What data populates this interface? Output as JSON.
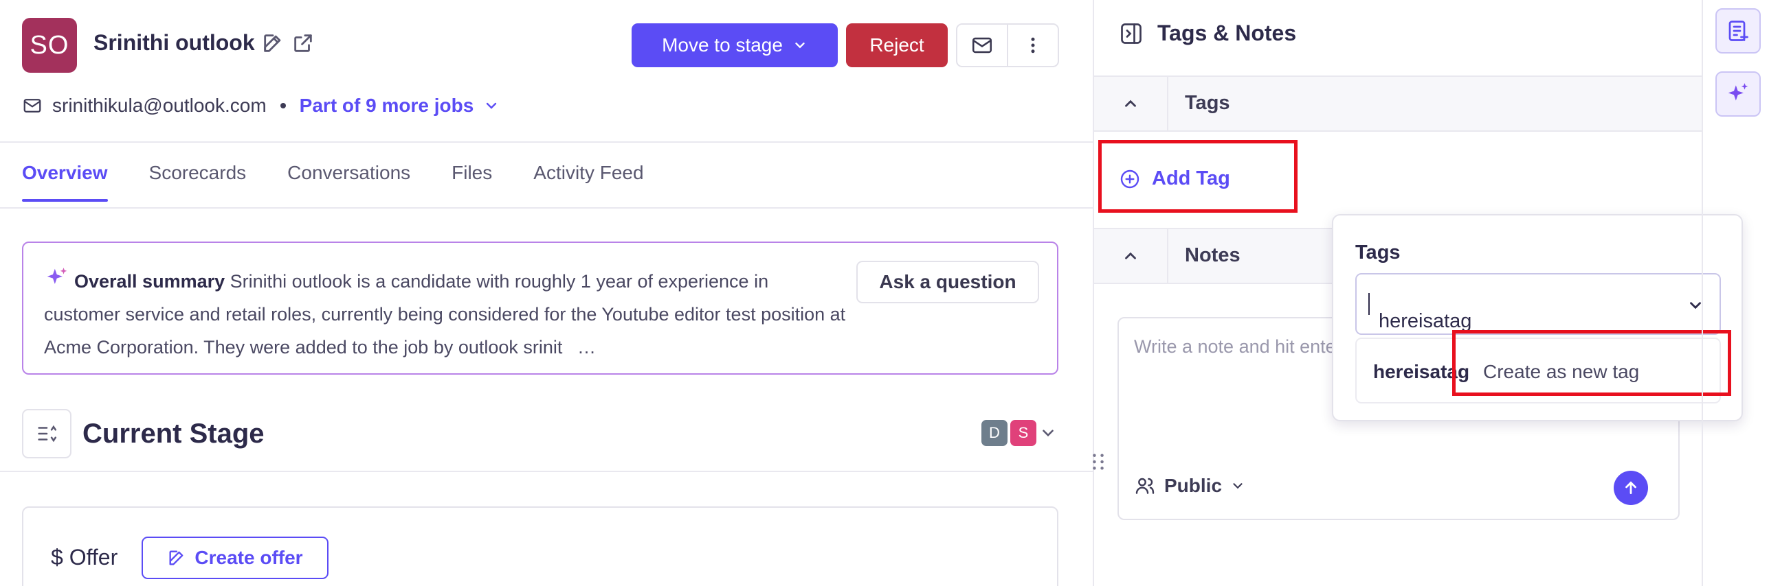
{
  "candidate": {
    "initials": "SO",
    "name": "Srinithi outlook",
    "email": "srinithikula@outlook.com",
    "more_jobs": "Part of 9 more jobs"
  },
  "actions": {
    "move_to_stage": "Move to stage",
    "reject": "Reject"
  },
  "tabs": [
    "Overview",
    "Scorecards",
    "Conversations",
    "Files",
    "Activity Feed"
  ],
  "summary": {
    "title": "Overall summary",
    "text": "Srinithi outlook is a candidate with roughly 1 year of experience in customer service and retail roles, currently being considered for the Youtube editor test position at Acme Corporation. They were added to the job by outlook srinit",
    "ellipsis": "…",
    "ask_button": "Ask a question"
  },
  "stage": {
    "title": "Current Stage",
    "assignees": [
      {
        "initial": "D",
        "color": "#6e7e8c"
      },
      {
        "initial": "S",
        "color": "#e0417a"
      }
    ]
  },
  "offer": {
    "label": "$ Offer",
    "create_button": "Create offer"
  },
  "panel": {
    "title": "Tags & Notes",
    "tags_section": "Tags",
    "add_tag": "Add Tag",
    "notes_section": "Notes",
    "note_placeholder": "Write a note and hit enter",
    "visibility": "Public"
  },
  "tag_popover": {
    "label": "Tags",
    "input_value": "hereisatag",
    "option_value": "hereisatag",
    "option_hint": "Create as new tag"
  },
  "colors": {
    "accent": "#5b4cf5",
    "reject": "#c2303f",
    "avatar": "#a3315c",
    "highlight": "#e8101e"
  }
}
